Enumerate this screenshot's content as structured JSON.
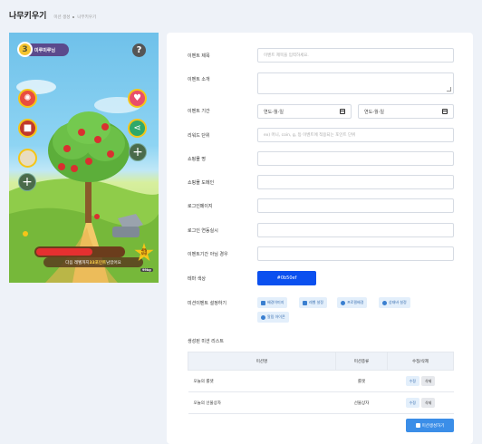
{
  "header": {
    "title": "나무키우기",
    "breadcrumb": [
      "미션 생성",
      "나무키우기"
    ]
  },
  "game": {
    "level": "3",
    "level_label": "미루미루님",
    "help": "?",
    "progress_fraction": 0.65,
    "msg_prefix": "다음 레벨까지 ",
    "msg_highlight": "33포인트",
    "msg_suffix": " 남았어요",
    "reward_label": "레벨\n보상",
    "weight": "99kg"
  },
  "form": {
    "title_label": "이벤트 제목",
    "title_placeholder": "이벤트 제목을 입력하세요.",
    "intro_label": "이벤트 소개",
    "period_label": "이벤트 기간",
    "date_start": "연도-월-일",
    "date_end": "연도-월-일",
    "reward_unit_label": "리워드 단위",
    "reward_unit_placeholder": "ex) 머니, coin, g, 등 이벤트에 적용되는 포인트 단위",
    "mall_name_label": "쇼핑몰 명",
    "mall_domain_label": "쇼핑몰 도메인",
    "login_page_label": "로그인페이지",
    "login_linked_label": "로그인 연동실시",
    "out_of_period_label": "이벤트기간 아님 경우",
    "theme_label": "테마 색상",
    "theme_color": "#0b50ef",
    "mission_settings_label": "미션이벤트 설정하기",
    "chips": [
      "배경이미지",
      "레벨 설정",
      "프로필배경",
      "상태바 설정",
      "알림 아이콘"
    ]
  },
  "list": {
    "section_title": "생성된 미션 리스트",
    "headers": [
      "미션명",
      "미션종류",
      "수정/삭제"
    ],
    "rows": [
      {
        "name": "오늘의 룰렛",
        "type": "룰렛",
        "edit": "수정",
        "delete": "삭제"
      },
      {
        "name": "오늘의 선물상자",
        "type": "선물상자",
        "edit": "수정",
        "delete": "삭제"
      }
    ],
    "create_label": "미션생성하기"
  }
}
